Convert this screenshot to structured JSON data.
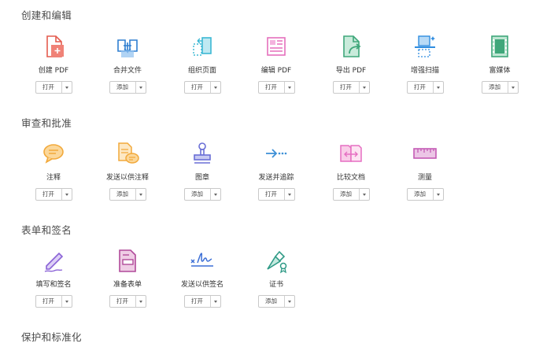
{
  "sections": [
    {
      "title": "创建和编辑",
      "tools": [
        {
          "label": "创建 PDF",
          "action": "打开",
          "icon": "create-pdf-icon",
          "color": "#e45b4e"
        },
        {
          "label": "合并文件",
          "action": "添加",
          "icon": "combine-files-icon",
          "color": "#2f7fd1"
        },
        {
          "label": "组织页面",
          "action": "打开",
          "icon": "organize-pages-icon",
          "color": "#3cb8d4"
        },
        {
          "label": "编辑 PDF",
          "action": "打开",
          "icon": "edit-pdf-icon",
          "color": "#e56fbc"
        },
        {
          "label": "导出 PDF",
          "action": "打开",
          "icon": "export-pdf-icon",
          "color": "#3fa77a"
        },
        {
          "label": "增强扫描",
          "action": "打开",
          "icon": "enhance-scan-icon",
          "color": "#2f8de0"
        },
        {
          "label": "富媒体",
          "action": "添加",
          "icon": "rich-media-icon",
          "color": "#3fa77a"
        }
      ]
    },
    {
      "title": "审查和批准",
      "tools": [
        {
          "label": "注释",
          "action": "打开",
          "icon": "comment-icon",
          "color": "#f2a93b"
        },
        {
          "label": "发送以供注释",
          "action": "添加",
          "icon": "send-for-comments-icon",
          "color": "#f2a93b"
        },
        {
          "label": "图章",
          "action": "添加",
          "icon": "stamp-icon",
          "color": "#6a6fd6"
        },
        {
          "label": "发送并追踪",
          "action": "打开",
          "icon": "send-track-icon",
          "color": "#3c8fd6"
        },
        {
          "label": "比较文档",
          "action": "添加",
          "icon": "compare-documents-icon",
          "color": "#e66fc2"
        },
        {
          "label": "测量",
          "action": "添加",
          "icon": "measure-icon",
          "color": "#c45bb5"
        }
      ]
    },
    {
      "title": "表单和签名",
      "tools": [
        {
          "label": "填写和签名",
          "action": "打开",
          "icon": "fill-sign-icon",
          "color": "#8a62d6"
        },
        {
          "label": "准备表单",
          "action": "打开",
          "icon": "prepare-form-icon",
          "color": "#b14a9a"
        },
        {
          "label": "发送以供签名",
          "action": "打开",
          "icon": "send-for-signature-icon",
          "color": "#3c6fd6"
        },
        {
          "label": "证书",
          "action": "添加",
          "icon": "certificate-icon",
          "color": "#2f9a86"
        }
      ]
    },
    {
      "title": "保护和标准化",
      "tools": []
    }
  ]
}
